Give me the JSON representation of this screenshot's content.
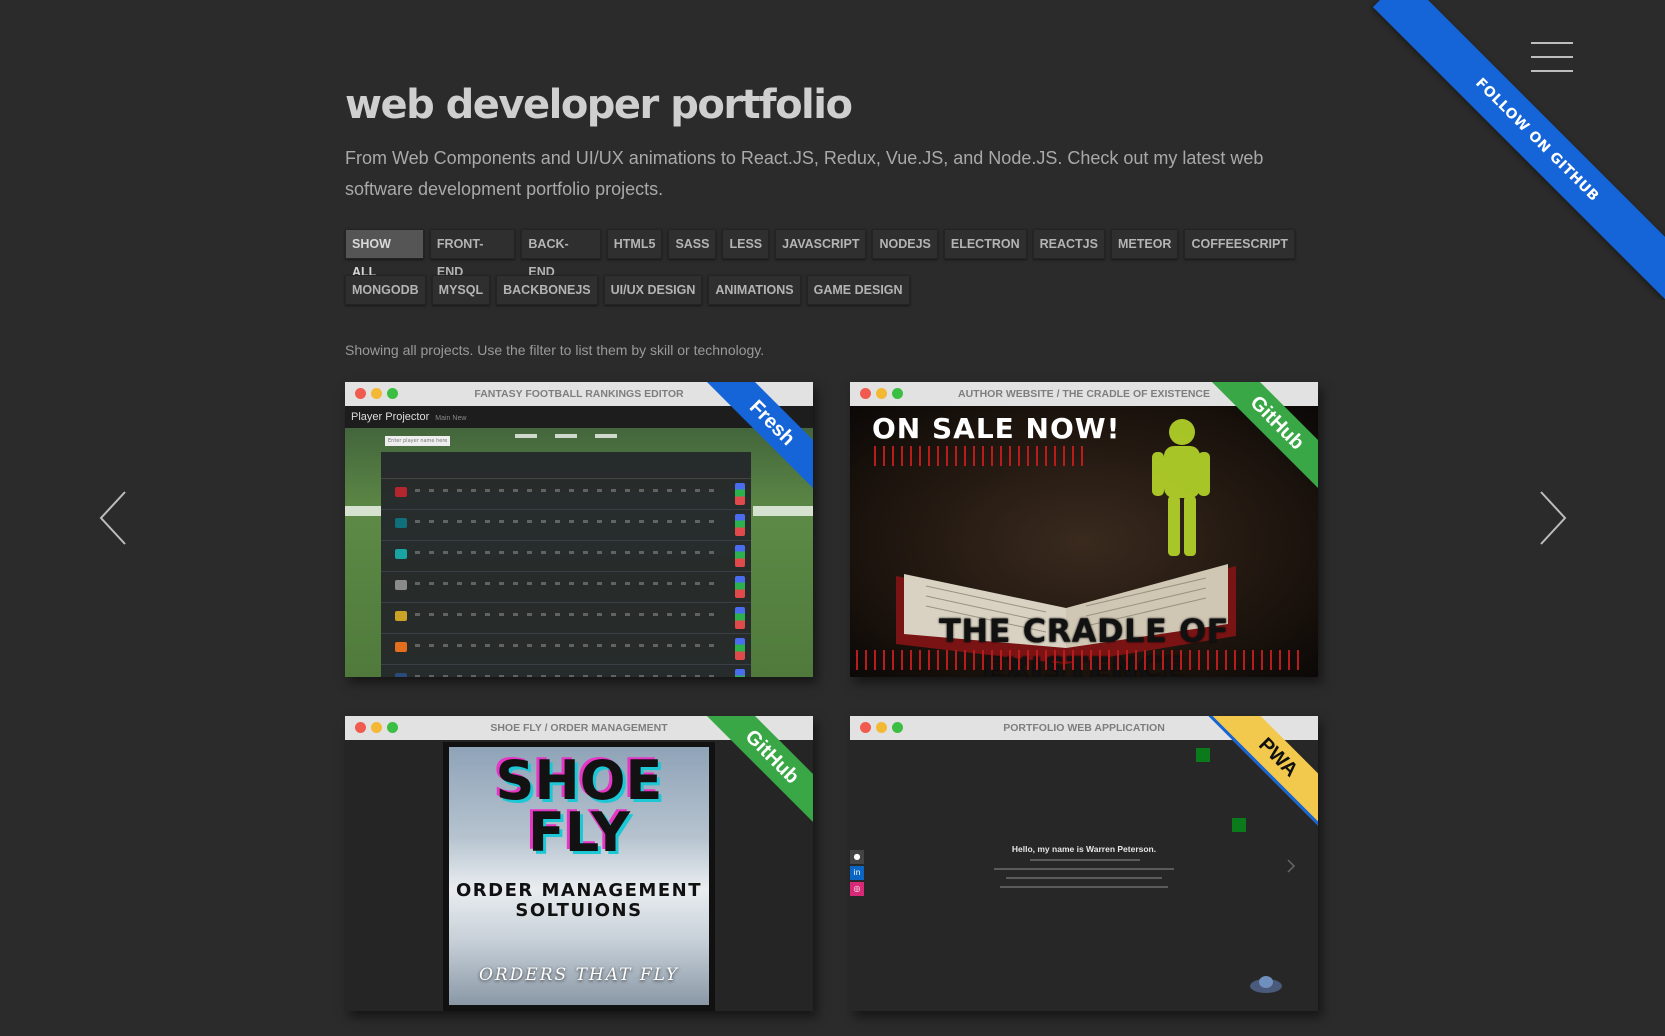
{
  "ribbon": {
    "label": "FOLLOW ON GITHUB",
    "color": "#1565d8"
  },
  "header": {
    "title": "web developer portfolio",
    "subtitle": "From Web Components and UI/UX animations to React.JS, Redux, Vue.JS, and Node.JS. Check out my latest web software development portfolio projects."
  },
  "filters": {
    "row1": [
      "SHOW ALL",
      "FRONT-END",
      "BACK-END",
      "HTML5",
      "SASS",
      "LESS",
      "JAVASCRIPT",
      "NODEJS",
      "ELECTRON",
      "REACTJS",
      "METEOR",
      "COFFEESCRIPT"
    ],
    "row2": [
      "MONGODB",
      "MYSQL",
      "BACKBONEJS",
      "UI/UX DESIGN",
      "ANIMATIONS",
      "GAME DESIGN"
    ],
    "active": "SHOW ALL"
  },
  "status_text": "Showing all projects. Use the filter to list them by skill or technology.",
  "icons": {
    "prev": "chevron-left-icon",
    "next": "chevron-right-icon",
    "menu": "hamburger-icon"
  },
  "projects": [
    {
      "title": "FANTASY FOOTBALL RANKINGS EDITOR",
      "badge": "Fresh",
      "badge_color": "#1565d8",
      "screen": {
        "app_name": "Player Projector",
        "nav": "Main  New",
        "search_placeholder": "Enter player name here"
      }
    },
    {
      "title": "AUTHOR WEBSITE / THE CRADLE OF EXISTENCE",
      "badge": "GitHub",
      "badge_color": "#3aa746",
      "screen": {
        "headline": "ON SALE NOW!",
        "book_title": "THE CRADLE OF EXISTENCE"
      }
    },
    {
      "title": "SHOE FLY / ORDER MANAGEMENT",
      "badge": "GitHub",
      "badge_color": "#3aa746",
      "screen": {
        "brand": "SHOE FLY",
        "sub": "ORDER MANAGEMENT SOLTUIONS",
        "tagline": "ORDERS THAT FLY"
      }
    },
    {
      "title": "PORTFOLIO WEB APPLICATION",
      "badge": "PWA",
      "badge_color": "#f2c94c",
      "screen": {
        "greeting": "Hello, my name is Warren Peterson."
      }
    }
  ]
}
